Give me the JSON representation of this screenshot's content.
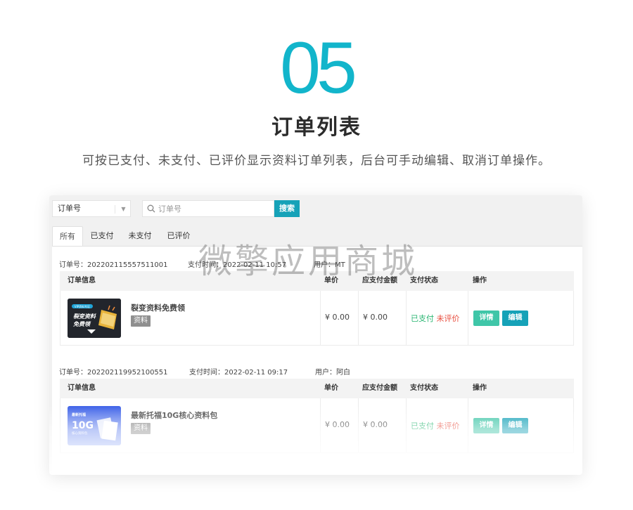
{
  "hero": {
    "number": "05",
    "title": "订单列表",
    "description": "可按已支付、未支付、已评价显示资料订单列表，后台可手动编辑、取消订单操作。"
  },
  "filter": {
    "select_value": "订单号",
    "search_placeholder": "订单号",
    "search_button": "搜索"
  },
  "tabs": [
    {
      "label": "所有",
      "active": true
    },
    {
      "label": "已支付",
      "active": false
    },
    {
      "label": "未支付",
      "active": false
    },
    {
      "label": "已评价",
      "active": false
    }
  ],
  "table_headers": {
    "info": "订单信息",
    "price": "单价",
    "amount": "应支付金额",
    "status": "支付状态",
    "action": "操作"
  },
  "orders": [
    {
      "order_no_label": "订单号：",
      "order_no": "202202115557511001",
      "pay_time_label": "支付时间：",
      "pay_time": "2022-02-11 10:57",
      "user_label": "用户：",
      "user": "MT",
      "product_name": "裂变资料免费领",
      "product_tag": "资料",
      "thumb_badge": "VIP资料专区",
      "thumb_text_line1": "裂变资料",
      "thumb_text_line2": "免费领",
      "price": "¥ 0.00",
      "amount": "¥ 0.00",
      "status_paid": "已支付",
      "status_rating": "未评价",
      "detail_button": "详情",
      "edit_button": "编辑"
    },
    {
      "order_no_label": "订单号：",
      "order_no": "202202119952100551",
      "pay_time_label": "支付时间：",
      "pay_time": "2022-02-11 09:17",
      "user_label": "用户：",
      "user": "阿白",
      "product_name": "最新托福10G核心资料包",
      "product_tag": "资料",
      "thumb_text_line1": "最新托福",
      "thumb_text_line2": "10G",
      "thumb_text_line3": "核心资料包",
      "price": "¥ 0.00",
      "amount": "¥ 0.00",
      "status_paid": "已支付",
      "status_rating": "未评价",
      "detail_button": "详情",
      "edit_button": "编辑"
    }
  ],
  "watermark": "微擎应用商城",
  "colors": {
    "accent": "#12b5cb",
    "button_primary": "#16a2b8",
    "button_detail": "#3fc6a8",
    "status_paid": "#2bb673",
    "status_unrated": "#e84c3d"
  }
}
